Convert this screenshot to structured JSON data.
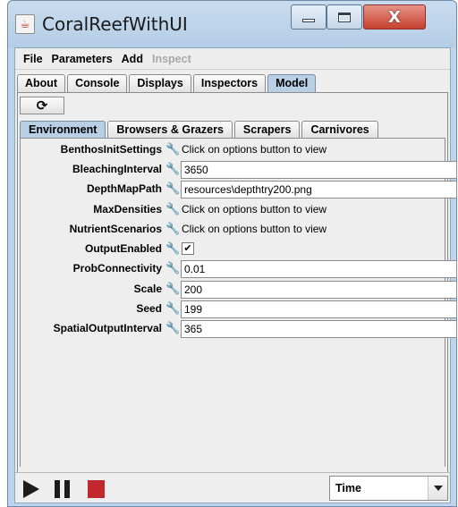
{
  "window": {
    "title": "CoralReefWithUI",
    "close_glyph": "X"
  },
  "menu": {
    "items": [
      {
        "label": "File",
        "enabled": true
      },
      {
        "label": "Parameters",
        "enabled": true
      },
      {
        "label": "Add",
        "enabled": true
      },
      {
        "label": "Inspect",
        "enabled": false
      }
    ]
  },
  "tabs": {
    "items": [
      "About",
      "Console",
      "Displays",
      "Inspectors",
      "Model"
    ],
    "selected": "Model"
  },
  "toolbar": {
    "refresh_icon": "refresh-icon",
    "refresh_glyph": "⟳"
  },
  "subtabs": {
    "items": [
      "Environment",
      "Browsers & Grazers",
      "Scrapers",
      "Carnivores"
    ],
    "selected": "Environment"
  },
  "properties": [
    {
      "name": "BenthosInitSettings",
      "type": "options",
      "value": "Click on options button to view"
    },
    {
      "name": "BleachingInterval",
      "type": "field",
      "value": "3650"
    },
    {
      "name": "DepthMapPath",
      "type": "field",
      "value": "resources\\depthtry200.png"
    },
    {
      "name": "MaxDensities",
      "type": "options",
      "value": "Click on options button to view"
    },
    {
      "name": "NutrientScenarios",
      "type": "options",
      "value": "Click on options button to view"
    },
    {
      "name": "OutputEnabled",
      "type": "checkbox",
      "value": "✔"
    },
    {
      "name": "ProbConnectivity",
      "type": "field",
      "value": "0.01"
    },
    {
      "name": "Scale",
      "type": "field",
      "value": "200"
    },
    {
      "name": "Seed",
      "type": "field",
      "value": "199"
    },
    {
      "name": "SpatialOutputInterval",
      "type": "field",
      "value": "365"
    }
  ],
  "controls": {
    "time_select": "Time"
  },
  "colors": {
    "stop": "#c1272d",
    "tab_selected": "#b8cfe5",
    "title_bar": "#bcd4ec"
  }
}
